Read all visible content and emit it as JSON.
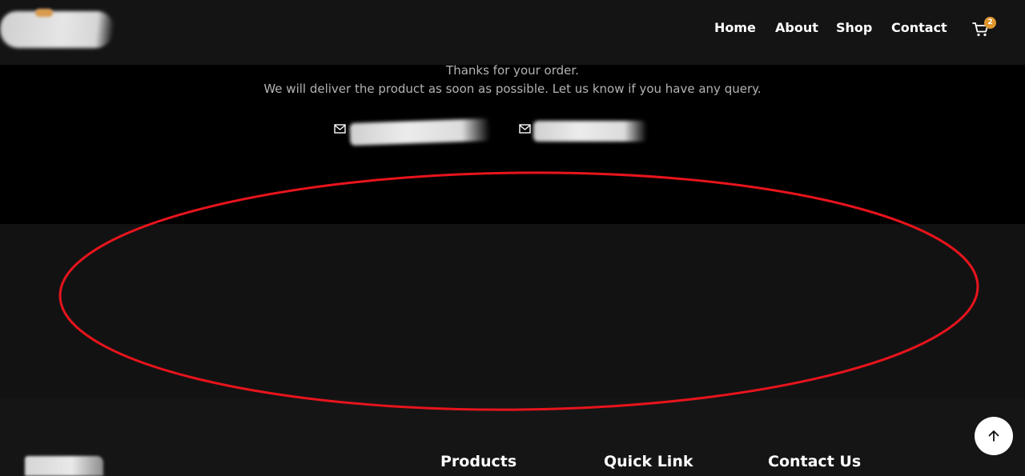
{
  "header": {
    "nav": [
      {
        "label": "Home"
      },
      {
        "label": "About"
      },
      {
        "label": "Shop"
      },
      {
        "label": "Contact"
      }
    ],
    "cart": {
      "icon": "cart-icon",
      "count": "2",
      "badge_color": "#e0962f"
    }
  },
  "thanks": {
    "line1": "Thanks for your order.",
    "line2": "We will deliver the product as soon as possible. Let us know if you have any query.",
    "contacts": [
      {
        "icon": "mail-icon"
      },
      {
        "icon": "mail-icon"
      }
    ]
  },
  "annotation": {
    "shape": "ellipse",
    "color": "#e8141c"
  },
  "footer": {
    "headings": [
      "Products",
      "Quick Link",
      "Contact Us"
    ],
    "scroll_top_icon": "arrow-up-icon"
  }
}
